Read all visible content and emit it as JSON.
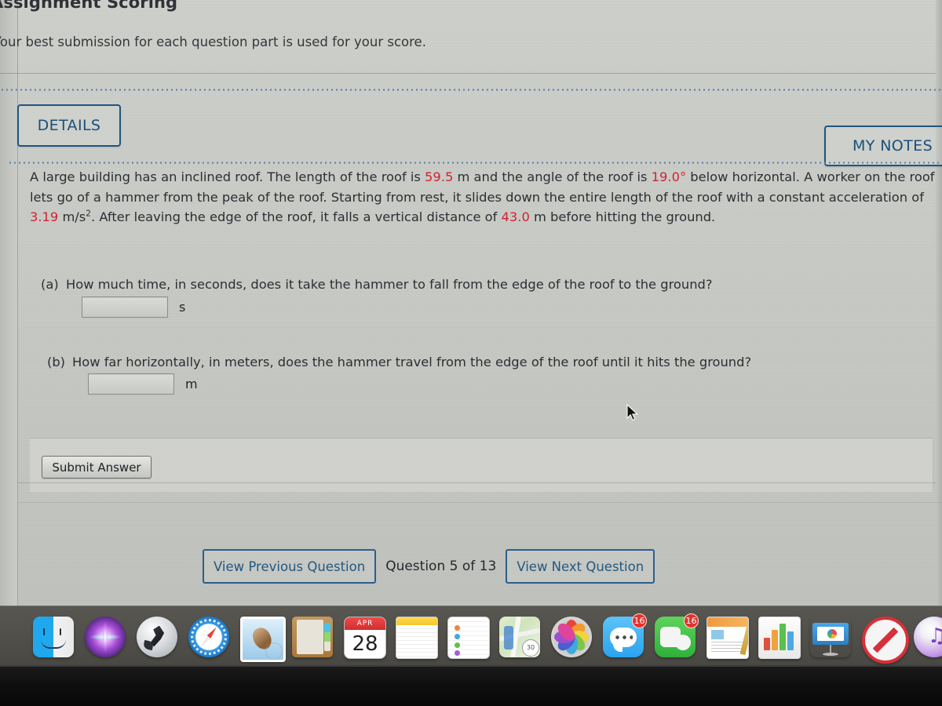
{
  "page": {
    "title": "Assignment Scoring",
    "subtitle": "Your best submission for each question part is used for your score."
  },
  "header": {
    "details_label": "DETAILS",
    "my_notes_label": "MY NOTES"
  },
  "question": {
    "text_part1": "A large building has an inclined roof. The length of the roof is ",
    "roof_length": "59.5",
    "text_part2": " m and the angle of the roof is ",
    "roof_angle": "19.0°",
    "text_part3": " below horizontal. A worker on the roof lets go of a hammer from the peak of the roof. Starting from rest, it slides down the entire length of the roof with a constant acceleration of ",
    "acceleration": "3.19",
    "text_part4": " m/s",
    "accel_exponent": "2",
    "text_part5": ". After leaving the edge of the roof, it falls a vertical distance of ",
    "fall_distance": "43.0",
    "text_part6": " m before hitting the ground.",
    "parts": [
      {
        "label": "(a)",
        "prompt": "How much time, in seconds, does it take the hammer to fall from the edge of the roof to the ground?",
        "value": "",
        "unit": "s"
      },
      {
        "label": "(b)",
        "prompt": "How far horizontally, in meters, does the hammer travel from the edge of the roof until it hits the ground?",
        "value": "",
        "unit": "m"
      }
    ]
  },
  "actions": {
    "submit_label": "Submit Answer"
  },
  "navigation": {
    "previous_label": "View Previous Question",
    "counter": "Question 5 of 13",
    "next_label": "View Next Question"
  },
  "colors": {
    "accent_blue": "#1b4f79",
    "value_red": "#cf2333",
    "page_bg": "#c9cbc6",
    "dock_bg": "#5c5a54"
  },
  "dock": {
    "items": [
      {
        "name": "finder-icon",
        "label": "Finder",
        "badge": ""
      },
      {
        "name": "siri-icon",
        "label": "Siri",
        "badge": ""
      },
      {
        "name": "launchpad-icon",
        "label": "Launchpad",
        "badge": ""
      },
      {
        "name": "safari-icon",
        "label": "Safari",
        "badge": ""
      },
      {
        "name": "mail-icon",
        "label": "Mail",
        "badge": ""
      },
      {
        "name": "contacts-icon",
        "label": "Contacts",
        "badge": ""
      },
      {
        "name": "calendar-icon",
        "label": "Calendar",
        "badge": "",
        "month": "APR",
        "day": "28"
      },
      {
        "name": "notes-icon",
        "label": "Notes",
        "badge": ""
      },
      {
        "name": "reminders-icon",
        "label": "Reminders",
        "badge": ""
      },
      {
        "name": "maps-icon",
        "label": "Maps",
        "badge": ""
      },
      {
        "name": "photos-icon",
        "label": "Photos",
        "badge": ""
      },
      {
        "name": "messages-icon",
        "label": "Messages",
        "badge": "16"
      },
      {
        "name": "facetime-icon",
        "label": "FaceTime",
        "badge": "16"
      },
      {
        "name": "pages-icon",
        "label": "Pages",
        "badge": ""
      },
      {
        "name": "numbers-icon",
        "label": "Numbers",
        "badge": ""
      },
      {
        "name": "keynote-icon",
        "label": "Keynote",
        "badge": ""
      },
      {
        "name": "blocked-app-icon",
        "label": "Blocked",
        "badge": ""
      },
      {
        "name": "itunes-icon",
        "label": "iTunes",
        "badge": ""
      }
    ]
  }
}
